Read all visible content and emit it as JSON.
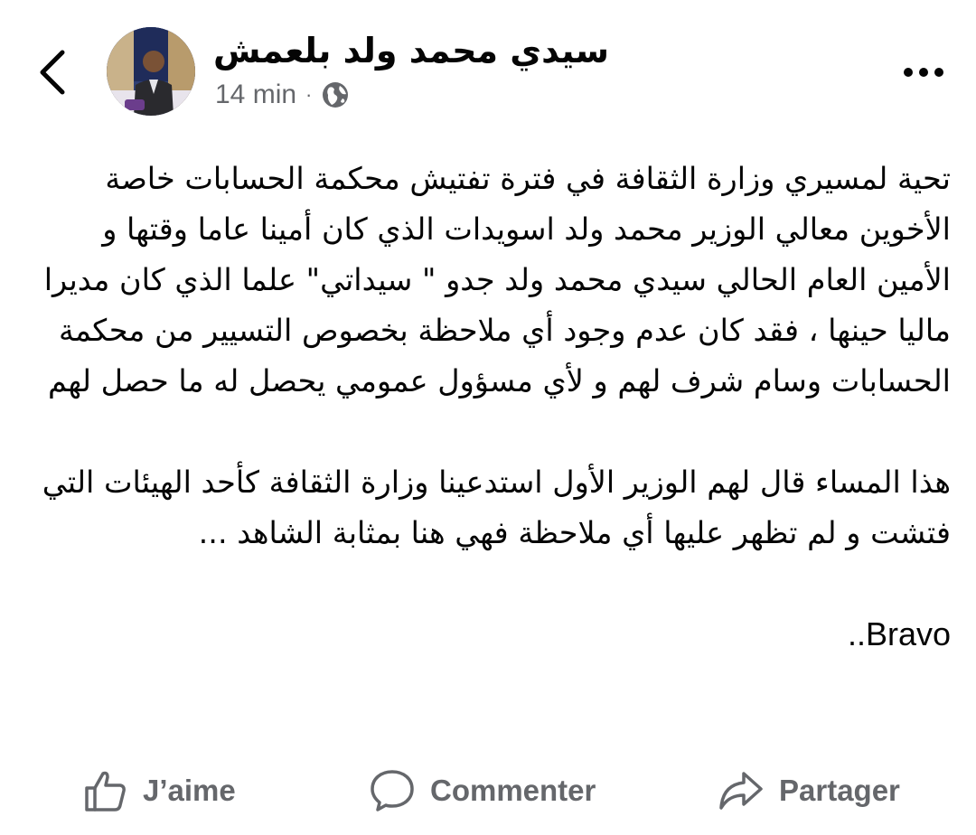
{
  "header": {
    "back_icon": "chevron-left-icon",
    "author_name": "سيدي محمد ولد بلعمش",
    "time": "14 min",
    "separator": "·",
    "audience_icon": "globe-icon",
    "more_icon": "more-horizontal-icon"
  },
  "post": {
    "paragraphs": [
      "تحية لمسيري وزارة الثقافة في فترة تفتيش محكمة الحسابات خاصة الأخوين معالي الوزير محمد ولد اسويدات الذي كان أمينا عاما وقتها و الأمين العام الحالي سيدي محمد ولد جدو \" سيداتي\" علما الذي كان مديرا ماليا حينها ، فقد كان عدم وجود أي ملاحظة بخصوص التسيير من محكمة الحسابات وسام شرف لهم و لأي مسؤول عمومي يحصل له ما حصل لهم",
      "هذا المساء قال لهم الوزير الأول استدعينا وزارة الثقافة كأحد الهيئات التي فتشت و لم تظهر عليها أي ملاحظة فهي هنا بمثابة الشاهد ...",
      "Bravo.."
    ]
  },
  "actions": {
    "like_label": "J’aime",
    "comment_label": "Commenter",
    "share_label": "Partager",
    "like_icon": "thumbs-up-icon",
    "comment_icon": "comment-bubble-icon",
    "share_icon": "share-arrow-icon"
  },
  "colors": {
    "text": "#050505",
    "secondary": "#65676b",
    "background": "#ffffff"
  }
}
